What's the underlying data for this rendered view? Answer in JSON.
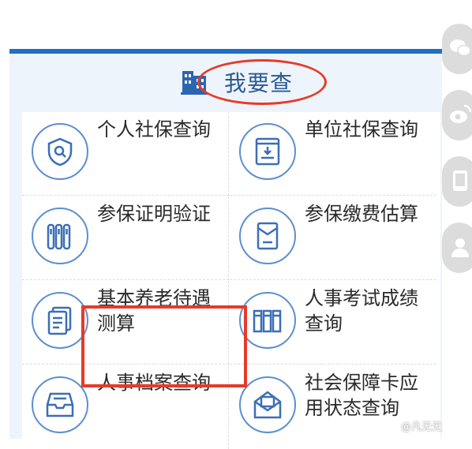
{
  "header": {
    "title": "我要查",
    "icon": "building-icon"
  },
  "services": [
    {
      "label": "个人社保查询",
      "icon": "person-search-icon"
    },
    {
      "label": "单位社保查询",
      "icon": "folder-doc-icon"
    },
    {
      "label": "参保证明验证",
      "icon": "binders-icon"
    },
    {
      "label": "参保缴费估算",
      "icon": "envelope-doc-icon"
    },
    {
      "label": "基本养老待遇测算",
      "icon": "documents-icon"
    },
    {
      "label": "人事考试成绩查询",
      "icon": "bookshelf-icon"
    },
    {
      "label": "人事档案查询",
      "icon": "inbox-tray-icon"
    },
    {
      "label": "社会保障卡应用状态查询",
      "icon": "mail-icon"
    }
  ],
  "share": [
    "wechat-icon",
    "weibo-icon",
    "mobile-icon",
    "user-icon"
  ],
  "watermark": "@凡无无",
  "colors": {
    "accent": "#1f6fc5",
    "title": "#2b5b96",
    "highlight": "#e53b2a",
    "panel_bg": "#eef4fb"
  }
}
